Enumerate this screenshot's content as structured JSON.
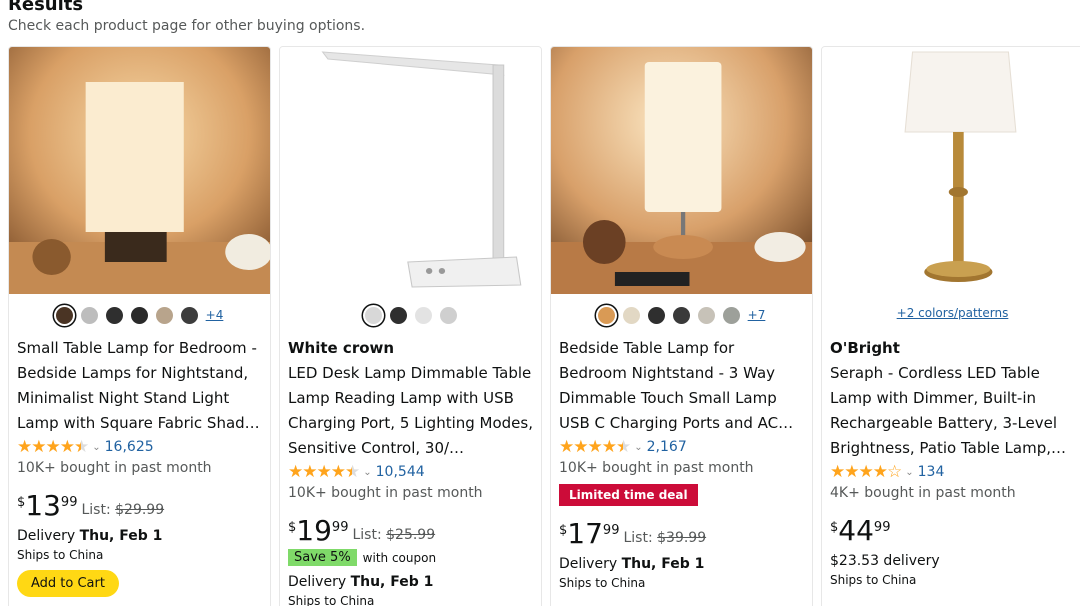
{
  "header": {
    "title": "Results",
    "subtitle": "Check each product page for other buying options."
  },
  "products": [
    {
      "brand": "",
      "title": "Small Table Lamp for Bedroom - Bedside Lamps for Nightstand, Minimalist Night Stand Light Lamp with Square Fabric Shad…",
      "swatch_colors": [
        "#4a3424",
        "#bdbdbd",
        "#2f2f2f",
        "#2a2a2a",
        "#b8a48c",
        "#3d3d3d"
      ],
      "more_label": "+4",
      "stars": "★★★★★",
      "rating": 4.5,
      "review_count": "16,625",
      "bought": "10K+ bought in past month",
      "deal_badge": "",
      "price_symbol": "$",
      "price_whole": "13",
      "price_fraction": "99",
      "list_label": "List:",
      "list_price": "$29.99",
      "coupon_save": "",
      "coupon_text": "",
      "delivery_label": "Delivery",
      "delivery_date": "Thu, Feb 1",
      "ships": "Ships to China",
      "cart_label": "Add to Cart"
    },
    {
      "brand": "White crown",
      "title": "LED Desk Lamp Dimmable Table Lamp Reading Lamp with USB Charging Port, 5 Lighting Modes, Sensitive Control, 30/…",
      "swatch_colors": [
        "#d8d8d8",
        "#2f2f2f",
        "#e3e3e3",
        "#cfcfcf"
      ],
      "more_label": "",
      "stars": "★★★★★",
      "rating": 4.5,
      "review_count": "10,544",
      "bought": "10K+ bought in past month",
      "deal_badge": "",
      "price_symbol": "$",
      "price_whole": "19",
      "price_fraction": "99",
      "list_label": "List:",
      "list_price": "$25.99",
      "coupon_save": "Save 5%",
      "coupon_text": "with coupon",
      "delivery_label": "Delivery",
      "delivery_date": "Thu, Feb 1",
      "ships": "Ships to China",
      "cart_label": ""
    },
    {
      "brand": "",
      "title": "Bedside Table Lamp for Bedroom Nightstand - 3 Way Dimmable Touch Small Lamp USB C Charging Ports and AC…",
      "swatch_colors": [
        "#d99a55",
        "#e2d8c4",
        "#2f2f2f",
        "#3a3a3a",
        "#c7c2b8",
        "#9da09a"
      ],
      "more_label": "+7",
      "stars": "★★★★★",
      "rating": 4.5,
      "review_count": "2,167",
      "bought": "10K+ bought in past month",
      "deal_badge": "Limited time deal",
      "price_symbol": "$",
      "price_whole": "17",
      "price_fraction": "99",
      "list_label": "List:",
      "list_price": "$39.99",
      "coupon_save": "",
      "coupon_text": "",
      "delivery_label": "Delivery",
      "delivery_date": "Thu, Feb 1",
      "ships": "Ships to China",
      "cart_label": ""
    },
    {
      "brand": "O'Bright",
      "title": "Seraph - Cordless LED Table Lamp with Dimmer, Built-in Rechargeable Battery, 3-Level Brightness, Patio Table Lamp,…",
      "swatch_colors": [],
      "more_label": "",
      "colors_link": "+2 colors/patterns",
      "stars": "★★★★★",
      "rating": 4.0,
      "review_count": "134",
      "bought": "4K+ bought in past month",
      "deal_badge": "",
      "price_symbol": "$",
      "price_whole": "44",
      "price_fraction": "99",
      "list_label": "",
      "list_price": "",
      "coupon_save": "",
      "coupon_text": "",
      "delivery_label": "$23.53 delivery",
      "delivery_date": "",
      "ships": "Ships to China",
      "cart_label": ""
    }
  ]
}
